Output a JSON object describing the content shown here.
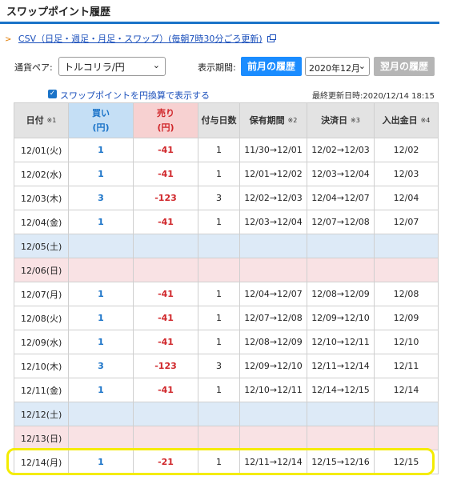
{
  "page_title": "スワップポイント履歴",
  "csv_link": "CSV（日足・週足・月足・スワップ）(毎朝7時30分ごろ更新)",
  "controls": {
    "pair_label": "通貨ペア:",
    "pair_value": "トルコリラ/円",
    "period_label": "表示期間:",
    "prev_button": "前月の履歴",
    "month_value": "2020年12月",
    "next_button": "翌月の履歴"
  },
  "options": {
    "yen_checkbox_label": "スワップポイントを円換算で表示する",
    "yen_checkbox_checked": true,
    "last_updated": "最終更新日時:2020/12/14 18:15"
  },
  "table": {
    "headers": {
      "date": "日付",
      "date_note": "※1",
      "buy": "買い",
      "buy_unit": "(円)",
      "sell": "売り",
      "sell_unit": "(円)",
      "days": "付与日数",
      "hold": "保有期間",
      "hold_note": "※2",
      "settle": "決済日",
      "settle_note": "※3",
      "deposit": "入出金日",
      "deposit_note": "※4"
    },
    "rows": [
      {
        "date": "12/01(火)",
        "buy": "1",
        "sell": "-41",
        "days": "1",
        "hold": "11/30→12/01",
        "settle": "12/02→12/03",
        "deposit": "12/02",
        "type": "weekday"
      },
      {
        "date": "12/02(水)",
        "buy": "1",
        "sell": "-41",
        "days": "1",
        "hold": "12/01→12/02",
        "settle": "12/03→12/04",
        "deposit": "12/03",
        "type": "weekday"
      },
      {
        "date": "12/03(木)",
        "buy": "3",
        "sell": "-123",
        "days": "3",
        "hold": "12/02→12/03",
        "settle": "12/04→12/07",
        "deposit": "12/04",
        "type": "weekday"
      },
      {
        "date": "12/04(金)",
        "buy": "1",
        "sell": "-41",
        "days": "1",
        "hold": "12/03→12/04",
        "settle": "12/07→12/08",
        "deposit": "12/07",
        "type": "weekday"
      },
      {
        "date": "12/05(土)",
        "buy": "",
        "sell": "",
        "days": "",
        "hold": "",
        "settle": "",
        "deposit": "",
        "type": "sat"
      },
      {
        "date": "12/06(日)",
        "buy": "",
        "sell": "",
        "days": "",
        "hold": "",
        "settle": "",
        "deposit": "",
        "type": "sun"
      },
      {
        "date": "12/07(月)",
        "buy": "1",
        "sell": "-41",
        "days": "1",
        "hold": "12/04→12/07",
        "settle": "12/08→12/09",
        "deposit": "12/08",
        "type": "weekday"
      },
      {
        "date": "12/08(火)",
        "buy": "1",
        "sell": "-41",
        "days": "1",
        "hold": "12/07→12/08",
        "settle": "12/09→12/10",
        "deposit": "12/09",
        "type": "weekday"
      },
      {
        "date": "12/09(水)",
        "buy": "1",
        "sell": "-41",
        "days": "1",
        "hold": "12/08→12/09",
        "settle": "12/10→12/11",
        "deposit": "12/10",
        "type": "weekday"
      },
      {
        "date": "12/10(木)",
        "buy": "3",
        "sell": "-123",
        "days": "3",
        "hold": "12/09→12/10",
        "settle": "12/11→12/14",
        "deposit": "12/11",
        "type": "weekday"
      },
      {
        "date": "12/11(金)",
        "buy": "1",
        "sell": "-41",
        "days": "1",
        "hold": "12/10→12/11",
        "settle": "12/14→12/15",
        "deposit": "12/14",
        "type": "weekday"
      },
      {
        "date": "12/12(土)",
        "buy": "",
        "sell": "",
        "days": "",
        "hold": "",
        "settle": "",
        "deposit": "",
        "type": "sat"
      },
      {
        "date": "12/13(日)",
        "buy": "",
        "sell": "",
        "days": "",
        "hold": "",
        "settle": "",
        "deposit": "",
        "type": "sun"
      },
      {
        "date": "12/14(月)",
        "buy": "1",
        "sell": "-21",
        "days": "1",
        "hold": "12/11→12/14",
        "settle": "12/15→12/16",
        "deposit": "12/15",
        "type": "weekday"
      }
    ]
  },
  "colors": {
    "accent": "#1a73c8",
    "buy": "#1a73c8",
    "sell": "#d0262a",
    "saturday_row": "#ddeaf7",
    "sunday_row": "#f9e2e4",
    "highlight": "#f4ec00"
  }
}
